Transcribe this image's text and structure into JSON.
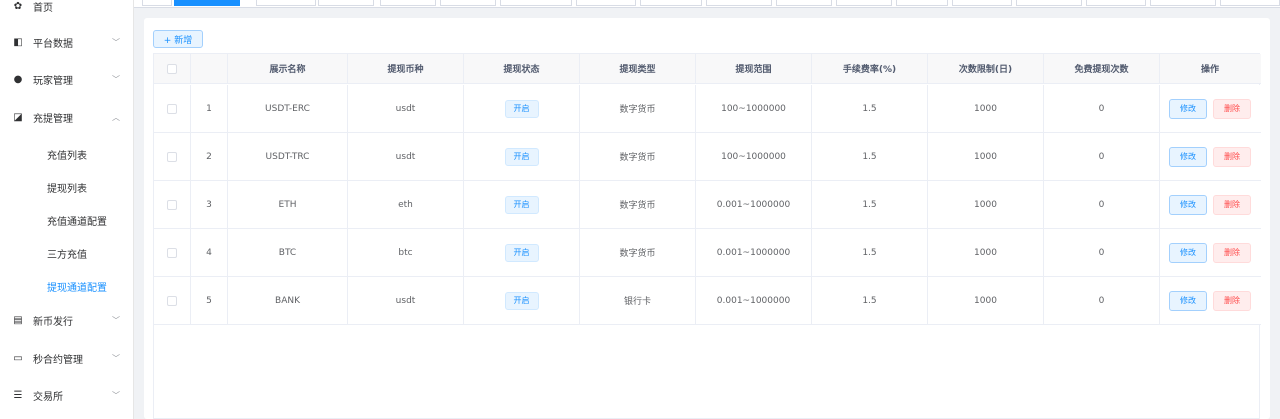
{
  "sidebar": {
    "menu": [
      {
        "icon": "dashboard-icon",
        "glyph": "✿",
        "label": "首页"
      },
      {
        "icon": "chart-icon",
        "glyph": "◧",
        "label": "平台数据"
      },
      {
        "icon": "user-icon",
        "glyph": "●",
        "label": "玩家管理"
      },
      {
        "icon": "copy-icon",
        "glyph": "◪",
        "label": "充提管理"
      },
      {
        "icon": "card-icon",
        "glyph": "▤",
        "label": "新币发行"
      },
      {
        "icon": "monitor-icon",
        "glyph": "▭",
        "label": "秒合约管理"
      },
      {
        "icon": "list-icon",
        "glyph": "☰",
        "label": "交易所"
      }
    ],
    "submenu": [
      {
        "label": "充值列表"
      },
      {
        "label": "提现列表"
      },
      {
        "label": "充值通道配置"
      },
      {
        "label": "三方充值"
      },
      {
        "label": "提现通道配置"
      }
    ],
    "chevron_down": "﹀",
    "chevron_up": "︿"
  },
  "toolbar": {
    "add_label": "+ 新增"
  },
  "table": {
    "headers": [
      "展示名称",
      "提现币种",
      "提现状态",
      "提现类型",
      "提现范围",
      "手续费率(%)",
      "次数限制(日)",
      "免费提现次数",
      "操作"
    ],
    "rows": [
      {
        "index": "1",
        "name": "USDT-ERC",
        "coin": "usdt",
        "status": "开启",
        "type": "数字货币",
        "range": "100~1000000",
        "fee": "1.5",
        "limit": "1000",
        "free": "0"
      },
      {
        "index": "2",
        "name": "USDT-TRC",
        "coin": "usdt",
        "status": "开启",
        "type": "数字货币",
        "range": "100~1000000",
        "fee": "1.5",
        "limit": "1000",
        "free": "0"
      },
      {
        "index": "3",
        "name": "ETH",
        "coin": "eth",
        "status": "开启",
        "type": "数字货币",
        "range": "0.001~1000000",
        "fee": "1.5",
        "limit": "1000",
        "free": "0"
      },
      {
        "index": "4",
        "name": "BTC",
        "coin": "btc",
        "status": "开启",
        "type": "数字货币",
        "range": "0.001~1000000",
        "fee": "1.5",
        "limit": "1000",
        "free": "0"
      },
      {
        "index": "5",
        "name": "BANK",
        "coin": "usdt",
        "status": "开启",
        "type": "银行卡",
        "range": "0.001~1000000",
        "fee": "1.5",
        "limit": "1000",
        "free": "0"
      }
    ],
    "edit_label": "修改",
    "delete_label": "删除"
  },
  "colors": {
    "primary": "#1890ff",
    "danger": "#ff4949",
    "text": "#606266"
  }
}
